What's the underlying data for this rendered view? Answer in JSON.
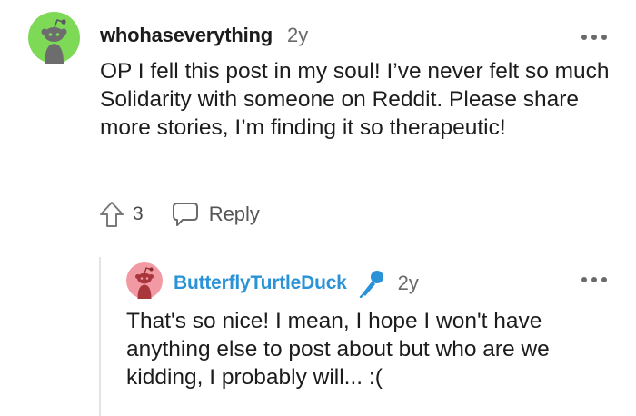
{
  "comments": [
    {
      "username": "whohaseverything",
      "age": "2y",
      "avatar_color": "#7ed957",
      "body": "OP I fell this post in my soul! I’ve never felt so much Solidarity with someone on Reddit. Please share more stories, I’m finding it so therapeutic!",
      "score": "3",
      "reply_label": "Reply",
      "icons": [
        "snoo-avatar-icon",
        "more-options-icon",
        "upvote-arrow-icon",
        "comment-bubble-icon"
      ]
    },
    {
      "username": "ButterflyTurtleDuck",
      "username_color": "#2a92d6",
      "age": "2y",
      "avatar_color": "#f29aa3",
      "body": "That's so nice! I mean, I hope I won't have anything else to post about but who are we kidding, I probably will... :(",
      "icons": [
        "snoo-avatar-icon",
        "microphone-icon",
        "more-options-icon"
      ]
    }
  ]
}
